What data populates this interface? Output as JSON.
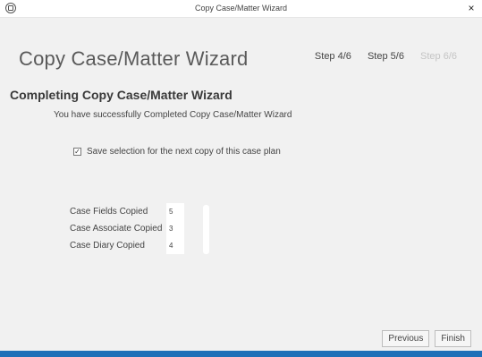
{
  "window": {
    "title": "Copy Case/Matter Wizard",
    "close_glyph": "×"
  },
  "header": {
    "title": "Copy Case/Matter Wizard",
    "steps": [
      {
        "label": "Step 4/6",
        "state": "visited"
      },
      {
        "label": "Step 5/6",
        "state": "current"
      },
      {
        "label": "Step 6/6",
        "state": "disabled"
      }
    ]
  },
  "main": {
    "section_title": "Completing Copy Case/Matter Wizard",
    "success_message": "You have successfully Completed Copy Case/Matter Wizard",
    "save_option": {
      "checked": true,
      "check_glyph": "✓",
      "label": "Save selection for the next copy of this case plan"
    },
    "stats": [
      {
        "label": "Case Fields Copied",
        "value": "5"
      },
      {
        "label": "Case Associate Copied",
        "value": "3"
      },
      {
        "label": "Case Diary Copied",
        "value": "4"
      }
    ]
  },
  "footer": {
    "previous_label": "Previous",
    "finish_label": "Finish"
  },
  "colors": {
    "accent_bar": "#1e6fb8",
    "panel_bg": "#f1f1f1",
    "disabled_text": "#c4c4c4"
  },
  "icons": {
    "app": "app-logo-icon",
    "close": "close-icon",
    "checkbox": "checkbox-checked-icon"
  }
}
